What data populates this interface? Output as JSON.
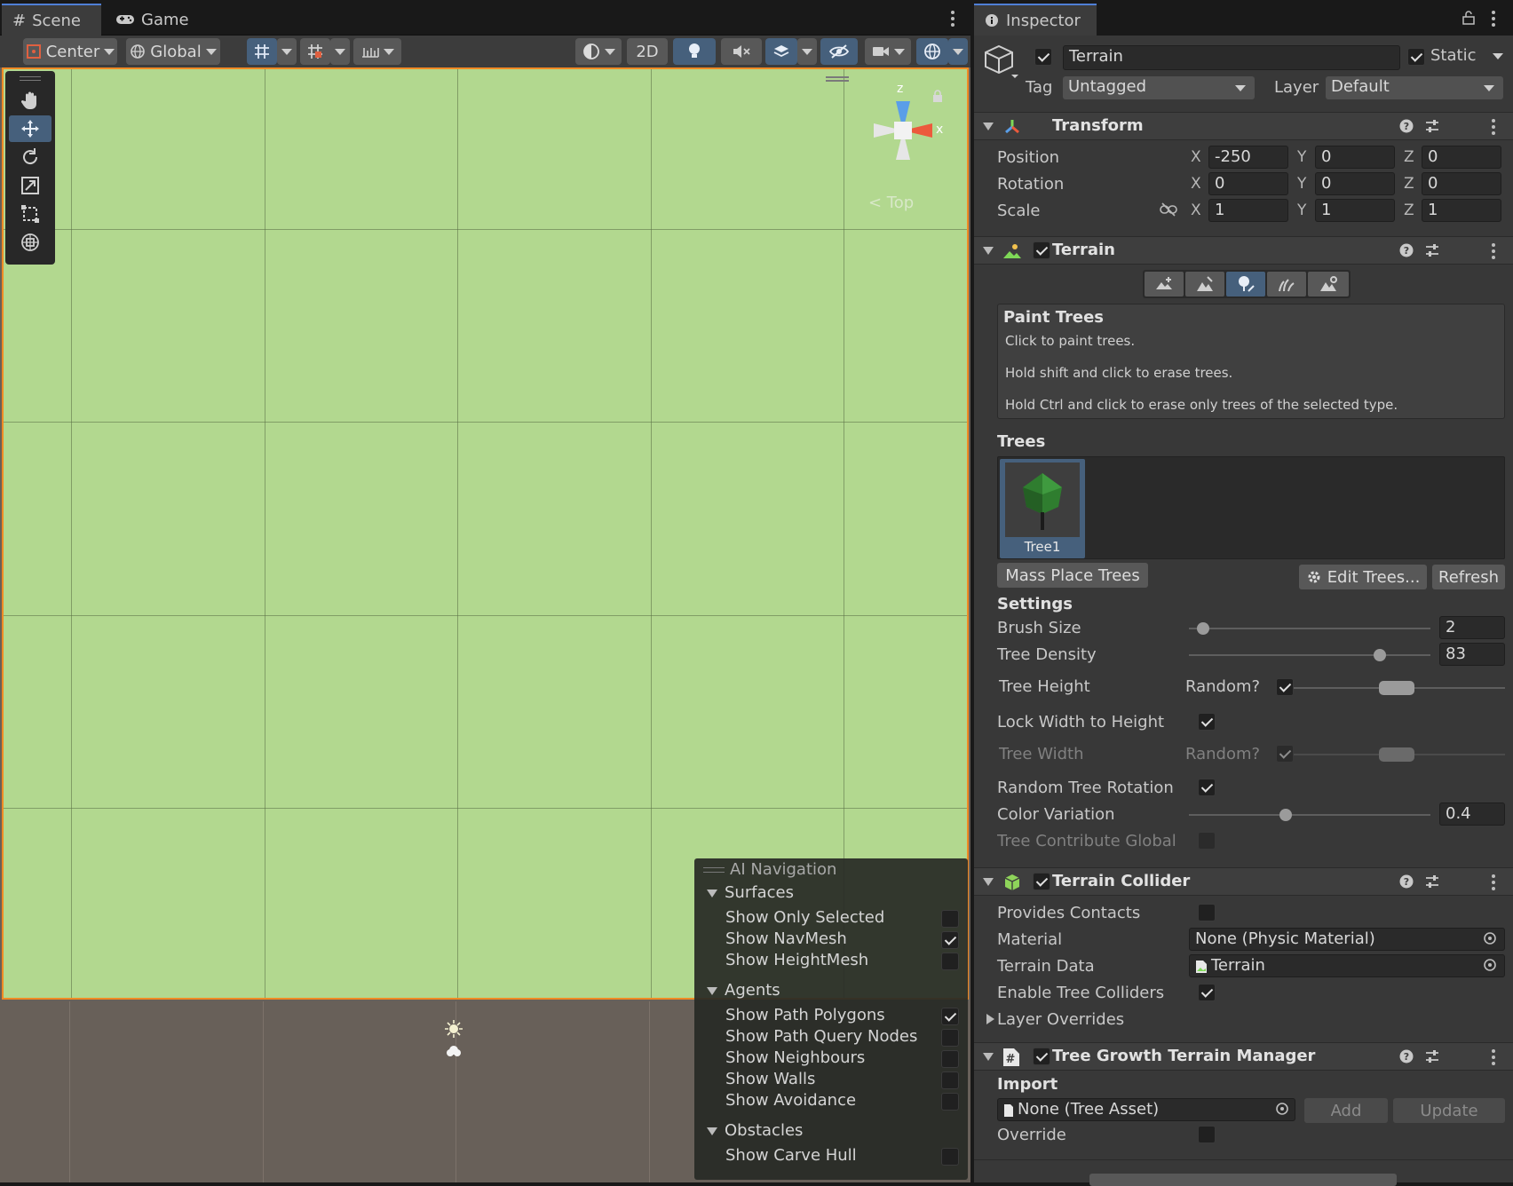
{
  "tabs": {
    "scene": "Scene",
    "game": "Game",
    "inspector": "Inspector"
  },
  "scene_toolbar": {
    "pivot": "Center",
    "space": "Global",
    "mode_2d": "2D"
  },
  "gizmo": {
    "axis_z": "z",
    "axis_x": "x",
    "view_label": "< Top"
  },
  "ai_navigation": {
    "title": "AI Navigation",
    "surfaces_header": "Surfaces",
    "surfaces": [
      {
        "label": "Show Only Selected",
        "checked": false
      },
      {
        "label": "Show NavMesh",
        "checked": true
      },
      {
        "label": "Show HeightMesh",
        "checked": false
      }
    ],
    "agents_header": "Agents",
    "agents": [
      {
        "label": "Show Path Polygons",
        "checked": true
      },
      {
        "label": "Show Path Query Nodes",
        "checked": false
      },
      {
        "label": "Show Neighbours",
        "checked": false
      },
      {
        "label": "Show Walls",
        "checked": false
      },
      {
        "label": "Show Avoidance",
        "checked": false
      }
    ],
    "obstacles_header": "Obstacles",
    "obstacles": [
      {
        "label": "Show Carve Hull",
        "checked": false
      }
    ]
  },
  "object": {
    "name": "Terrain",
    "static_label": "Static",
    "tag_label": "Tag",
    "tag_value": "Untagged",
    "layer_label": "Layer",
    "layer_value": "Default"
  },
  "transform": {
    "title": "Transform",
    "position_label": "Position",
    "rotation_label": "Rotation",
    "scale_label": "Scale",
    "position": {
      "x": "-250",
      "y": "0",
      "z": "0"
    },
    "rotation": {
      "x": "0",
      "y": "0",
      "z": "0"
    },
    "scale": {
      "x": "1",
      "y": "1",
      "z": "1"
    },
    "axis_x": "X",
    "axis_y": "Y",
    "axis_z": "Z"
  },
  "terrain": {
    "title": "Terrain",
    "paint_title": "Paint Trees",
    "help_1": "Click to paint trees.",
    "help_2": "Hold shift and click to erase trees.",
    "help_3": "Hold Ctrl and click to erase only trees of the selected type.",
    "trees_header": "Trees",
    "tree_item": "Tree1",
    "mass_place": "Mass Place Trees",
    "edit_trees": "Edit Trees...",
    "refresh": "Refresh",
    "settings_header": "Settings",
    "brush_size_label": "Brush Size",
    "brush_size_value": "2",
    "brush_size_fraction": 0.06,
    "tree_density_label": "Tree Density",
    "tree_density_value": "83",
    "tree_density_fraction": 0.79,
    "tree_height_label": "Tree Height",
    "random_label": "Random?",
    "lock_label": "Lock Width to Height",
    "tree_width_label": "Tree Width",
    "random_rotation_label": "Random Tree Rotation",
    "color_variation_label": "Color Variation",
    "color_variation_value": "0.4",
    "color_variation_fraction": 0.4,
    "contribute_gi_label": "Tree Contribute Global I"
  },
  "collider": {
    "title": "Terrain Collider",
    "provides_contacts_label": "Provides Contacts",
    "material_label": "Material",
    "material_value": "None (Physic Material)",
    "terrain_data_label": "Terrain Data",
    "terrain_data_value": "Terrain",
    "enable_tree_colliders_label": "Enable Tree Colliders",
    "layer_overrides_label": "Layer Overrides"
  },
  "tree_growth": {
    "title": "Tree Growth Terrain Manager",
    "import_header": "Import",
    "asset_value": "None (Tree Asset)",
    "add": "Add",
    "update": "Update",
    "override_label": "Override"
  },
  "colors": {
    "terrain": "#b2d88f",
    "selection_outline": "#f08a24",
    "accent": "#4f7fd6",
    "ground": "#686059"
  }
}
